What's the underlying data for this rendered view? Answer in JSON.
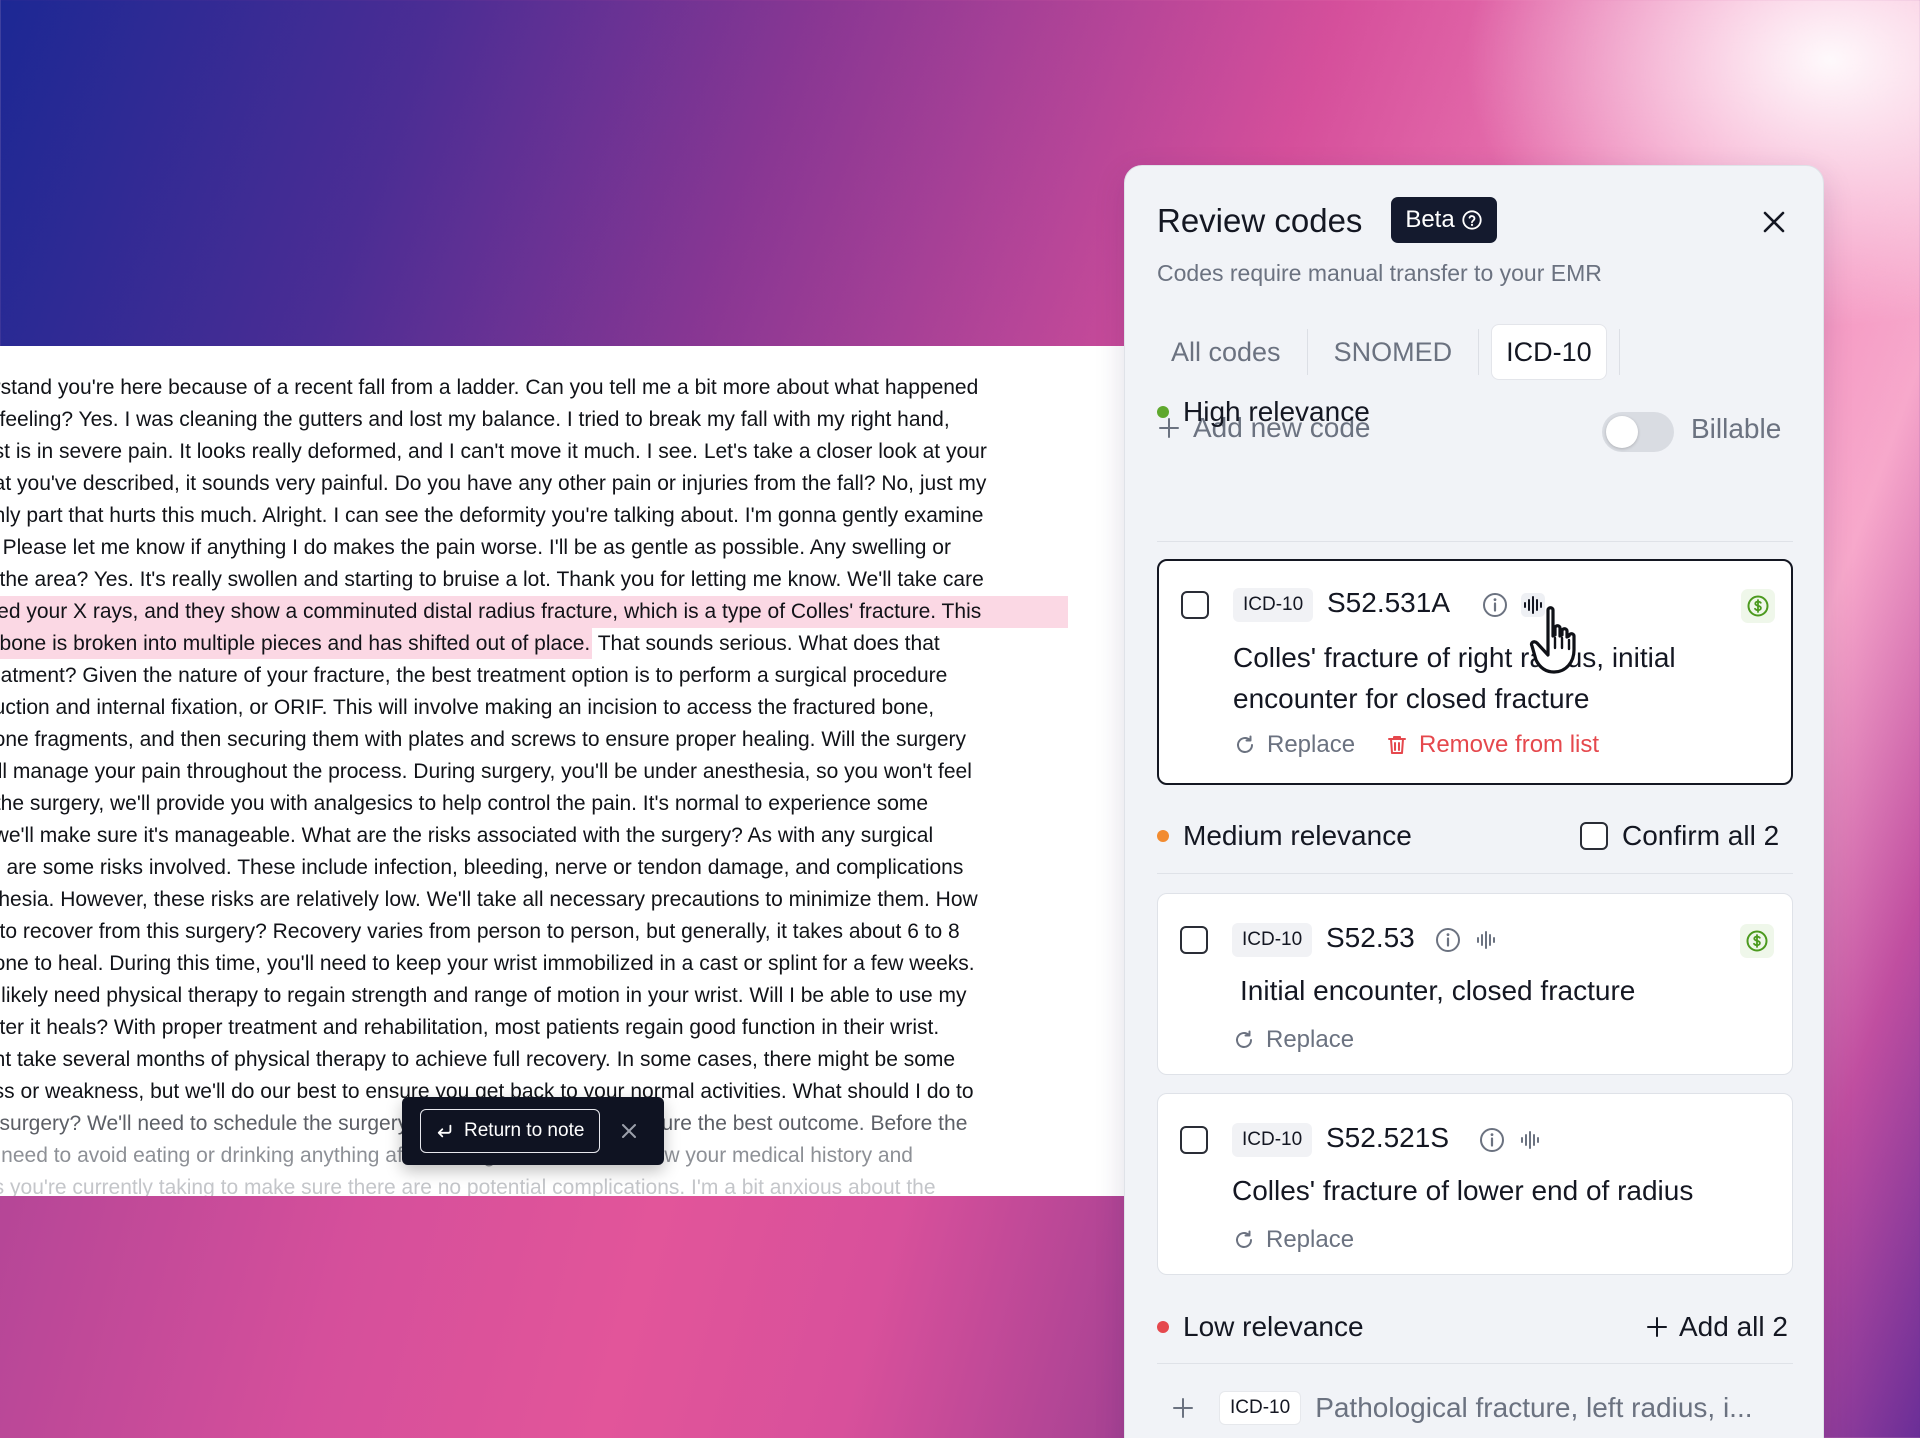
{
  "transcript": {
    "lines": [
      "erstand you're here because of a recent fall from a ladder. Can you tell me a bit more about what happened",
      "e feeling? Yes. I was cleaning the gutters and lost my balance. I tried to break my fall with my right hand,",
      "rist is in severe pain. It looks really deformed, and I can't move it much. I see. Let's take a closer look at your",
      "hat you've described, it sounds very painful. Do you have any other pain or injuries from the fall? No, just my",
      "only part that hurts this much. Alright. I can see the deformity you're talking about. I'm gonna gently examine",
      "y. Please let me know if anything I do makes the pain worse. I'll be as gentle as possible. Any swelling or",
      "d the area? Yes. It's really swollen and starting to bruise a lot. Thank you for letting me know. We'll take care",
      "wed your X rays, and they show a comminuted distal radius fracture, which is a type of Colles' fracture. This",
      "e bone is broken into multiple pieces and has shifted out of place.",
      " That sounds serious. What does that",
      "reatment? Given the nature of your fracture, the best treatment option is to perform a surgical procedure",
      "duction and internal fixation, or ORIF. This will involve making an incision to access the fractured bone,",
      "bone fragments, and then securing them with plates and screws to ensure proper healing. Will the surgery",
      "e'll manage your pain throughout the process. During surgery, you'll be under anesthesia, so you won't feel",
      "r the surgery, we'll provide you with analgesics to help control the pain. It's normal to experience some",
      "t we'll make sure it's manageable. What are the risks associated with the surgery? As with any surgical",
      "re are some risks involved. These include infection, bleeding, nerve or tendon damage, and complications",
      "sthesia. However, these risks are relatively low. We'll take all necessary precautions to minimize them. How",
      "e to recover from this surgery? Recovery varies from person to person, but generally, it takes about 6 to 8",
      "bone to heal. During this time, you'll need to keep your wrist immobilized in a cast or splint for a few weeks.",
      "'ll likely need physical therapy to regain strength and range of motion in your wrist. Will I be able to use my",
      "after it heals? With proper treatment and rehabilitation, most patients regain good function in their wrist.",
      "ght take several months of physical therapy to achieve full recovery. In some cases, there might be some",
      "ess or weakness, but we'll do our best to ensure you get back to your normal activities. What should I do to",
      "e surgery? We'll need to schedule the surgery as soon as possible to ensure the best outcome. Before the",
      "'ll need to avoid eating or drinking anything after midnight. We'll also review your medical history and",
      "ns you're currently taking to make sure there are no potential complications. I'm a bit anxious about the"
    ],
    "return_label": "Return to note"
  },
  "panel": {
    "title": "Review codes",
    "beta_label": "Beta",
    "subtitle": "Codes require manual transfer to your EMR",
    "tabs": [
      "All codes",
      "SNOMED",
      "ICD-10"
    ],
    "active_tab": "ICD-10",
    "add_code_label": "Add new code",
    "billable_label": "Billable",
    "billable_on": false,
    "sections": {
      "high": {
        "label": "High relevance",
        "color": "#5fa82e",
        "cards": [
          {
            "system": "ICD-10",
            "code": "S52.531A",
            "description": "Colles' fracture of right radius, initial encounter for closed fracture",
            "replace_label": "Replace",
            "remove_label": "Remove from list",
            "billable": true
          }
        ]
      },
      "medium": {
        "label": "Medium relevance",
        "color": "#f28b30",
        "confirm_label": "Confirm all 2",
        "cards": [
          {
            "system": "ICD-10",
            "code": "S52.53",
            "description": "Initial encounter, closed fracture",
            "replace_label": "Replace",
            "billable": true
          },
          {
            "system": "ICD-10",
            "code": "S52.521S",
            "description": "Colles' fracture of lower end of radius",
            "replace_label": "Replace",
            "billable": false
          }
        ]
      },
      "low": {
        "label": "Low relevance",
        "color": "#e5484d",
        "add_all_label": "Add all 2",
        "items": [
          {
            "system": "ICD-10",
            "description": "Pathological fracture, left radius, i..."
          }
        ]
      }
    }
  }
}
